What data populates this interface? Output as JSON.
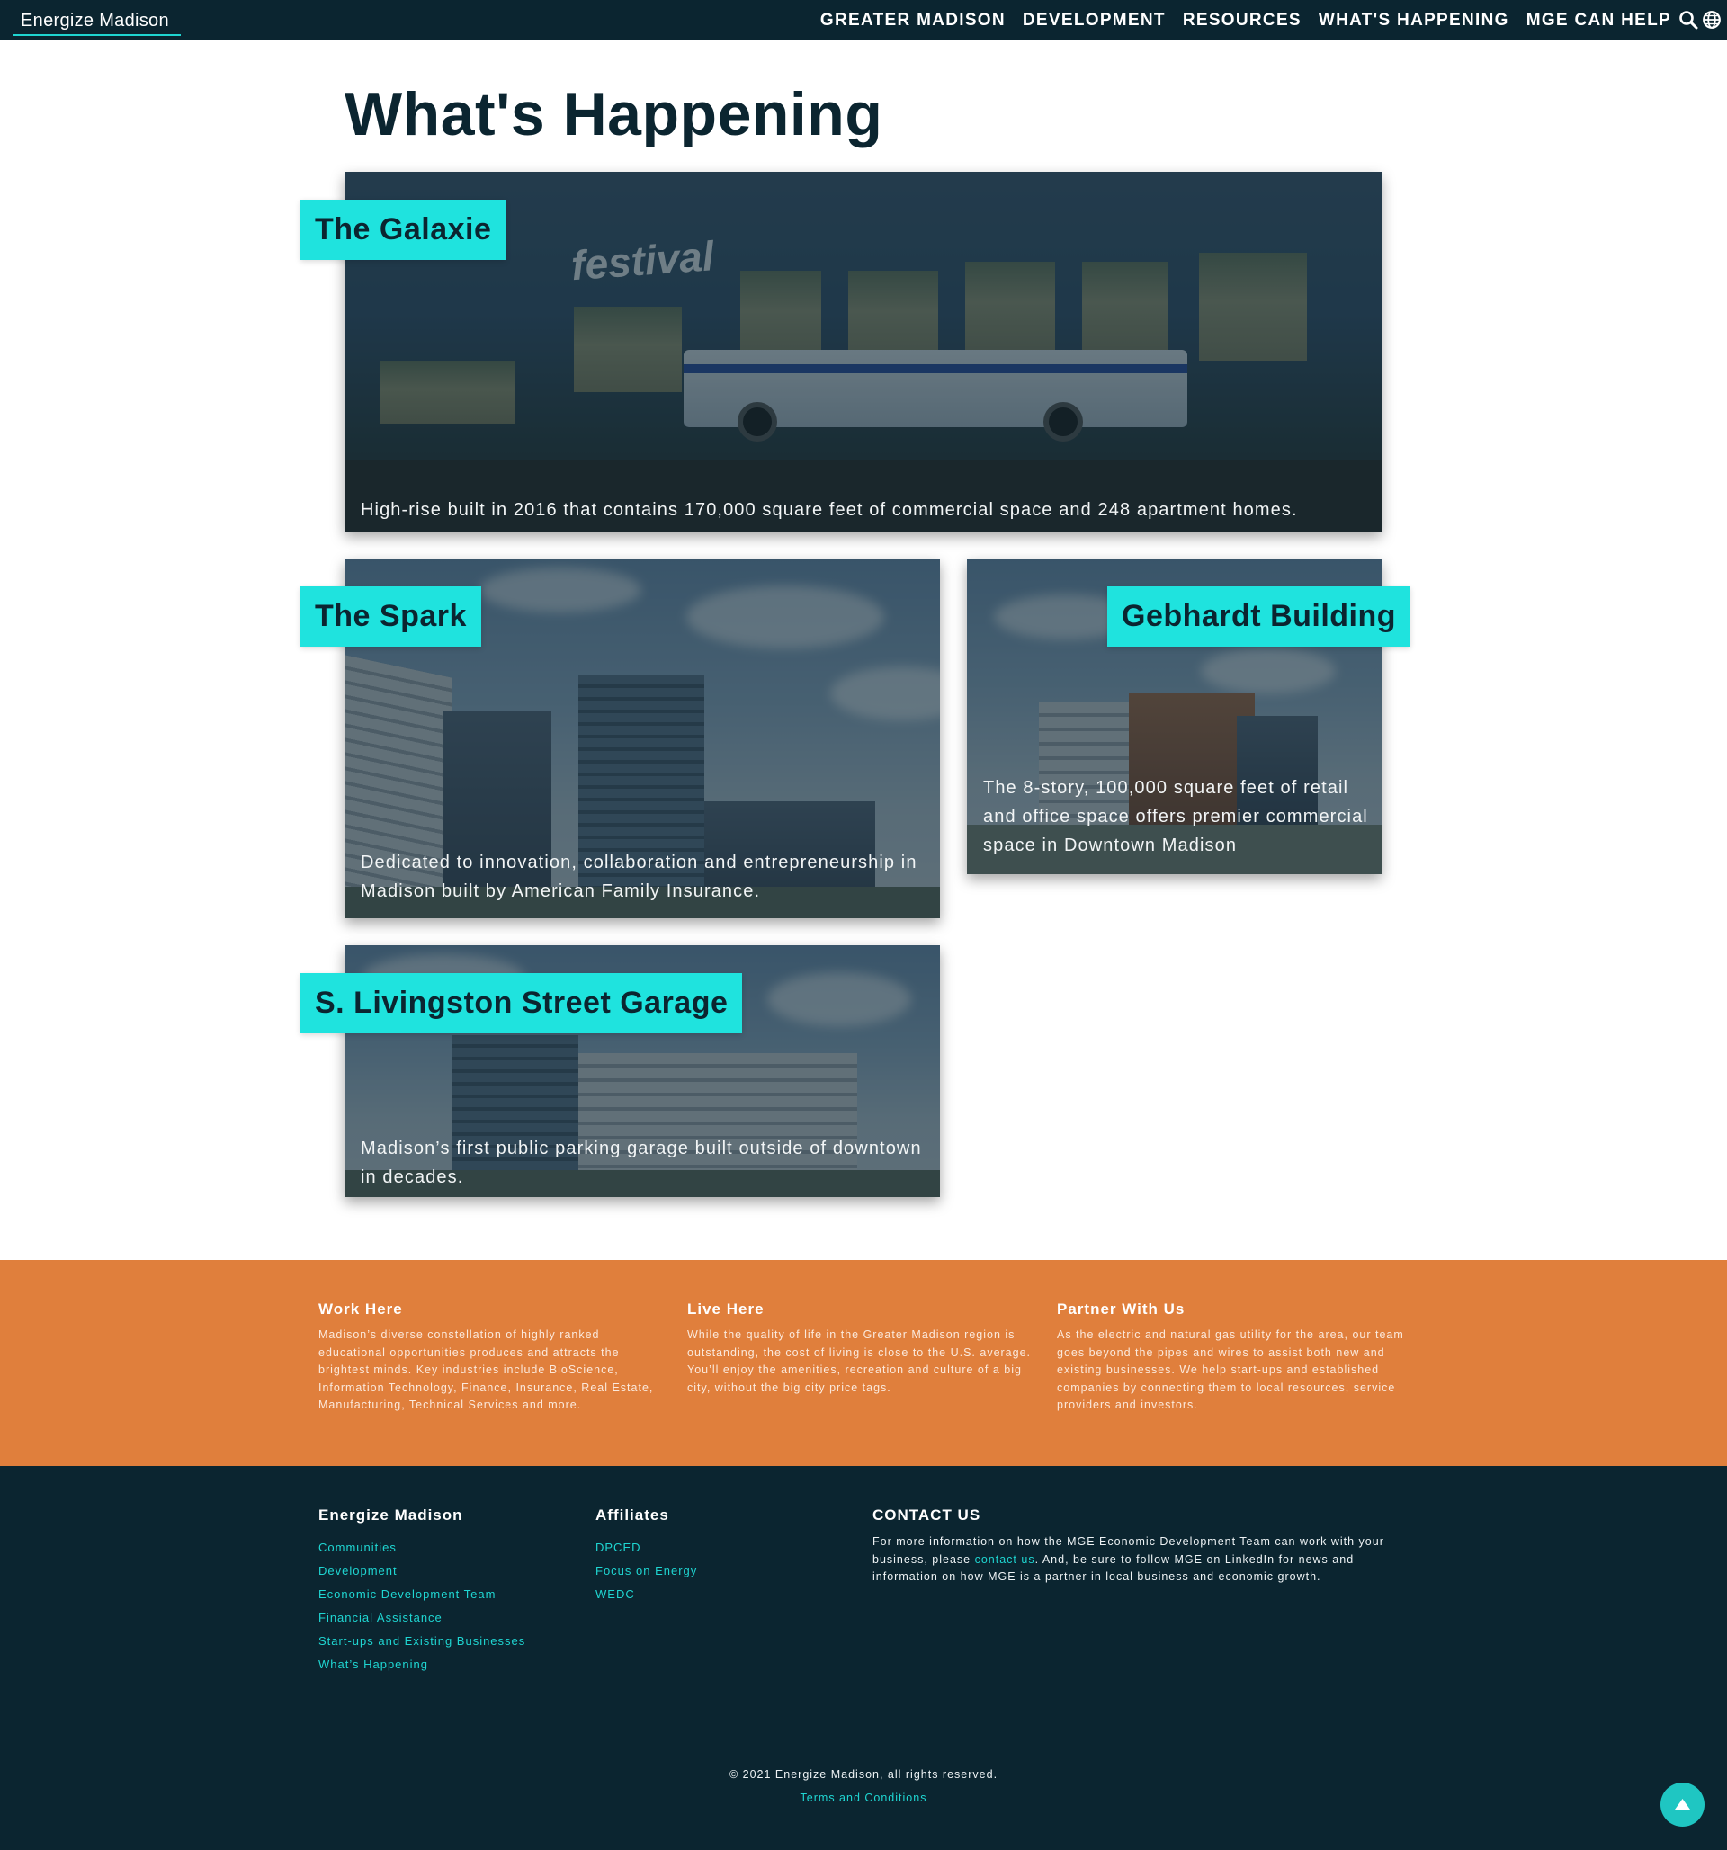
{
  "nav": {
    "brand": "Energize Madison",
    "menu": [
      "GREATER MADISON",
      "DEVELOPMENT",
      "RESOURCES",
      "WHAT'S HAPPENING",
      "MGE CAN HELP"
    ],
    "icons": [
      "search-icon",
      "globe-icon"
    ]
  },
  "page": {
    "title": "What's Happening"
  },
  "cards": [
    {
      "title": "The Galaxie",
      "desc": "High-rise built in 2016 that contains 170,000 square feet of commercial space and 248 apartment homes.",
      "sign": "festival"
    },
    {
      "title": "The Spark",
      "desc": "Dedicated to innovation, collaboration and entrepreneurship in Madison built by American Family Insurance."
    },
    {
      "title": "Gebhardt Building",
      "desc": "The 8-story, 100,000 square feet of retail and office space offers premier commercial space in Downtown Madison"
    },
    {
      "title": "S. Livingston Street Garage",
      "desc": "Madison’s first public parking garage built outside of downtown in decades."
    }
  ],
  "band": {
    "columns": [
      {
        "title": "Work Here",
        "text": "Madison’s diverse constellation of highly ranked educational opportunities produces and attracts the brightest minds. Key industries include BioScience, Information Technology, Finance, Insurance, Real Estate, Manufacturing, Technical Services and more."
      },
      {
        "title": "Live Here",
        "text": "While the quality of life in the Greater Madison region is outstanding, the cost of living is close to the U.S. average. You’ll enjoy the amenities, recreation and culture of a big city, without the big city price tags."
      },
      {
        "title": "Partner With Us",
        "text": "As the electric and natural gas utility for the area, our team goes beyond the pipes and wires to assist both new and existing businesses. We help start-ups and established companies by connecting them to local resources, service providers and investors."
      }
    ]
  },
  "footer": {
    "col1": {
      "title": "Energize Madison",
      "links": [
        "Communities",
        "Development",
        "Economic Development Team",
        "Financial Assistance",
        "Start-ups and Existing Businesses",
        "What’s Happening"
      ]
    },
    "col2": {
      "title": "Affiliates",
      "links": [
        "DPCED",
        "Focus on Energy",
        "WEDC"
      ]
    },
    "contact": {
      "title": "CONTACT US",
      "text_before": "For more information on how the MGE Economic Development Team can work with your business, please ",
      "link": "contact us",
      "text_after": ". And, be sure to follow MGE on LinkedIn for news and information on how MGE is a partner in local business and economic growth."
    },
    "copyright": "© 2021 Energize Madison, all rights reserved.",
    "terms": "Terms and Conditions",
    "back_to_top_icon": "arrow-up-icon"
  },
  "colors": {
    "navy": "#0b2530",
    "teal": "#1fe3de",
    "orange": "#e07f3c",
    "link": "#1fd6d2"
  }
}
